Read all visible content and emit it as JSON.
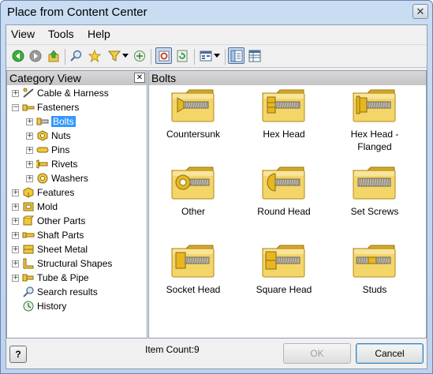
{
  "window": {
    "title": "Place from Content Center"
  },
  "menu": [
    "View",
    "Tools",
    "Help"
  ],
  "toolbar": {
    "icons": [
      "back-icon",
      "forward-icon",
      "up-folder-icon",
      "search-icon",
      "favorites-icon",
      "filter-icon",
      "filter-dropdown-icon",
      "refresh-icon",
      "autodrop-icon",
      "update-icon",
      "view-options-icon",
      "view-dropdown-icon",
      "tree-view-icon",
      "table-view-icon"
    ]
  },
  "category_view": {
    "title": "Category View",
    "items": [
      {
        "label": "Cable & Harness",
        "icon": "cable-harness-icon",
        "expander": "+",
        "level": 0
      },
      {
        "label": "Fasteners",
        "icon": "fasteners-icon",
        "expander": "-",
        "level": 0
      },
      {
        "label": "Bolts",
        "icon": "bolt-icon",
        "expander": "+",
        "level": 1,
        "selected": true
      },
      {
        "label": "Nuts",
        "icon": "nut-icon",
        "expander": "+",
        "level": 1
      },
      {
        "label": "Pins",
        "icon": "pin-icon",
        "expander": "+",
        "level": 1
      },
      {
        "label": "Rivets",
        "icon": "rivet-icon",
        "expander": "+",
        "level": 1
      },
      {
        "label": "Washers",
        "icon": "washer-icon",
        "expander": "+",
        "level": 1
      },
      {
        "label": "Features",
        "icon": "features-icon",
        "expander": "+",
        "level": 0
      },
      {
        "label": "Mold",
        "icon": "mold-icon",
        "expander": "+",
        "level": 0
      },
      {
        "label": "Other Parts",
        "icon": "other-parts-icon",
        "expander": "+",
        "level": 0
      },
      {
        "label": "Shaft Parts",
        "icon": "shaft-parts-icon",
        "expander": "+",
        "level": 0
      },
      {
        "label": "Sheet Metal",
        "icon": "sheet-metal-icon",
        "expander": "+",
        "level": 0
      },
      {
        "label": "Structural Shapes",
        "icon": "structural-shapes-icon",
        "expander": "+",
        "level": 0
      },
      {
        "label": "Tube & Pipe",
        "icon": "tube-pipe-icon",
        "expander": "+",
        "level": 0
      },
      {
        "label": "Search results",
        "icon": "search-results-icon",
        "expander": "",
        "level": 0
      },
      {
        "label": "History",
        "icon": "history-icon",
        "expander": "",
        "level": 0
      }
    ]
  },
  "content": {
    "title": "Bolts",
    "items": [
      {
        "label": "Countersunk",
        "icon": "countersunk-bolt-folder-icon"
      },
      {
        "label": "Hex Head",
        "icon": "hex-head-bolt-folder-icon"
      },
      {
        "label": "Hex Head -\nFlanged",
        "icon": "hex-head-flanged-bolt-folder-icon"
      },
      {
        "label": "Other",
        "icon": "other-bolt-folder-icon"
      },
      {
        "label": "Round Head",
        "icon": "round-head-bolt-folder-icon"
      },
      {
        "label": "Set Screws",
        "icon": "set-screw-folder-icon"
      },
      {
        "label": "Socket Head",
        "icon": "socket-head-bolt-folder-icon"
      },
      {
        "label": "Square Head",
        "icon": "square-head-bolt-folder-icon"
      },
      {
        "label": "Studs",
        "icon": "stud-folder-icon"
      }
    ]
  },
  "status": {
    "item_count": "Item Count:9"
  },
  "buttons": {
    "ok": "OK",
    "cancel": "Cancel",
    "help": "?"
  },
  "colors": {
    "folder": "#f3d568",
    "selection": "#3399ff"
  }
}
